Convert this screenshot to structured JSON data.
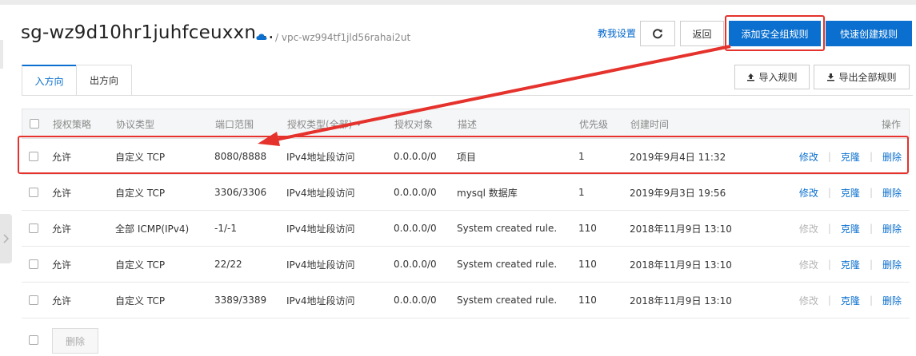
{
  "header": {
    "title": "sg-wz9d10hr1juhfceuxxn...",
    "vpc": "/ vpc-wz994tf1jld56rahai2ut",
    "help_link": "教我设置",
    "back_label": "返回",
    "add_rule_label": "添加安全组规则",
    "quick_create_label": "快速创建规则"
  },
  "tabs": [
    {
      "label": "入方向",
      "active": true
    },
    {
      "label": "出方向",
      "active": false
    }
  ],
  "toolbar": {
    "import_label": "导入规则",
    "export_label": "导出全部规则"
  },
  "table": {
    "columns": {
      "policy": "授权策略",
      "protocol": "协议类型",
      "port": "端口范围",
      "auth_type": "授权类型(全部)",
      "auth_object": "授权对象",
      "description": "描述",
      "priority": "优先级",
      "created": "创建时间",
      "actions": "操作"
    },
    "rows": [
      {
        "policy": "允许",
        "protocol": "自定义 TCP",
        "port": "8080/8888",
        "auth_type": "IPv4地址段访问",
        "auth_object": "0.0.0.0/0",
        "description": "项目",
        "priority": "1",
        "created": "2019年9月4日 11:32",
        "modify": "修改",
        "clone": "克隆",
        "delete": "删除",
        "modify_enabled": true
      },
      {
        "policy": "允许",
        "protocol": "自定义 TCP",
        "port": "3306/3306",
        "auth_type": "IPv4地址段访问",
        "auth_object": "0.0.0.0/0",
        "description": "mysql 数据库",
        "priority": "1",
        "created": "2019年9月3日 19:56",
        "modify": "修改",
        "clone": "克隆",
        "delete": "删除",
        "modify_enabled": true
      },
      {
        "policy": "允许",
        "protocol": "全部 ICMP(IPv4)",
        "port": "-1/-1",
        "auth_type": "IPv4地址段访问",
        "auth_object": "0.0.0.0/0",
        "description": "System created rule.",
        "priority": "110",
        "created": "2018年11月9日 13:10",
        "modify": "修改",
        "clone": "克隆",
        "delete": "删除",
        "modify_enabled": false
      },
      {
        "policy": "允许",
        "protocol": "自定义 TCP",
        "port": "22/22",
        "auth_type": "IPv4地址段访问",
        "auth_object": "0.0.0.0/0",
        "description": "System created rule.",
        "priority": "110",
        "created": "2018年11月9日 13:10",
        "modify": "修改",
        "clone": "克隆",
        "delete": "删除",
        "modify_enabled": false
      },
      {
        "policy": "允许",
        "protocol": "自定义 TCP",
        "port": "3389/3389",
        "auth_type": "IPv4地址段访问",
        "auth_object": "0.0.0.0/0",
        "description": "System created rule.",
        "priority": "110",
        "created": "2018年11月9日 13:10",
        "modify": "修改",
        "clone": "克隆",
        "delete": "删除",
        "modify_enabled": false
      }
    ],
    "bulk_delete_label": "删除"
  },
  "colors": {
    "primary": "#0a6fce",
    "annotation_red": "#e5322c"
  }
}
